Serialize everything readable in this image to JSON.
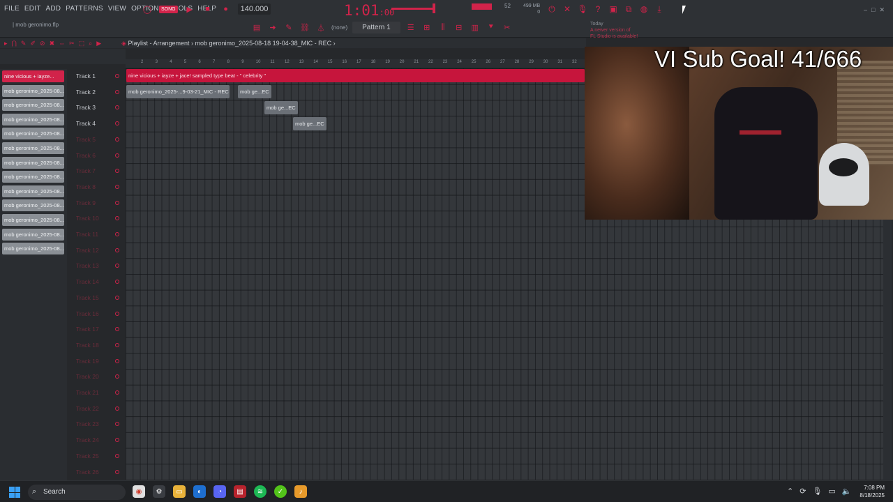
{
  "menu": [
    "FILE",
    "EDIT",
    "ADD",
    "PATTERNS",
    "VIEW",
    "OPTIONS",
    "TOOLS",
    "HELP"
  ],
  "hint_file": "| mob geronimo.flp",
  "transport": {
    "song_label": "SONG",
    "tempo": "140.000"
  },
  "time": {
    "main": "1:01",
    "sub": ":00"
  },
  "cpu_num": "52",
  "mem": "499 MB\n0",
  "pattern": {
    "none_label": "(none)",
    "selected": "Pattern 1"
  },
  "news": {
    "head": "Today",
    "line1": "A newer version of",
    "line2": "FL Studio is available!"
  },
  "playlist": {
    "title_prefix": "Playlist - Arrangement",
    "title_sep": "›",
    "title_clip": "mob geronimo_2025-08-18 19-04-38_MIC - REC",
    "title_end": "›"
  },
  "ruler": [
    "2",
    "3",
    "4",
    "5",
    "6",
    "7",
    "8",
    "9",
    "10",
    "11",
    "12",
    "13",
    "14",
    "15",
    "16",
    "17",
    "18",
    "19",
    "20",
    "21",
    "22",
    "23",
    "24",
    "25",
    "26",
    "27",
    "28",
    "29",
    "30",
    "31",
    "32"
  ],
  "picker": [
    "nine vicious + iayze...",
    "mob geronimo_2025-08...",
    "mob geronimo_2025-08...",
    "mob geronimo_2025-08...",
    "mob geronimo_2025-08...",
    "mob geronimo_2025-08...",
    "mob geronimo_2025-08...",
    "mob geronimo_2025-08...",
    "mob geronimo_2025-08...",
    "mob geronimo_2025-08...",
    "mob geronimo_2025-08...",
    "mob geronimo_2025-08...",
    "mob geronimo_2025-08..."
  ],
  "tracks": [
    "Track 1",
    "Track 2",
    "Track 3",
    "Track 4",
    "Track 5",
    "Track 6",
    "Track 7",
    "Track 8",
    "Track 9",
    "Track 10",
    "Track 11",
    "Track 12",
    "Track 13",
    "Track 14",
    "Track 15",
    "Track 16",
    "Track 17",
    "Track 18",
    "Track 19",
    "Track 20",
    "Track 21",
    "Track 22",
    "Track 23",
    "Track 24",
    "Track 25",
    "Track 26"
  ],
  "clips": {
    "beat": "nine vicious + iayze + jace! sampled type beat - \" celebrity \"",
    "rec1": "mob geronimo_2025-...9-03-21_MIC - REC",
    "rec2": "mob ge...EC",
    "rec3": "mob ge...EC",
    "rec4": "mob ge...EC"
  },
  "overlay": {
    "sub_goal": "VI Sub Goal! 41/666"
  },
  "taskbar": {
    "search": "Search",
    "time": "7:08 PM",
    "date": "8/18/2025"
  },
  "colors": {
    "accent": "#d1234a",
    "bg": "#26282b",
    "grid": "#34373b",
    "clip_gray": "#6b7077"
  },
  "icons": [
    "play-icon",
    "stop-icon",
    "record-icon",
    "search-icon",
    "windows-icon",
    "chrome-icon",
    "folder-icon",
    "spotify-icon",
    "fl-studio-icon"
  ]
}
